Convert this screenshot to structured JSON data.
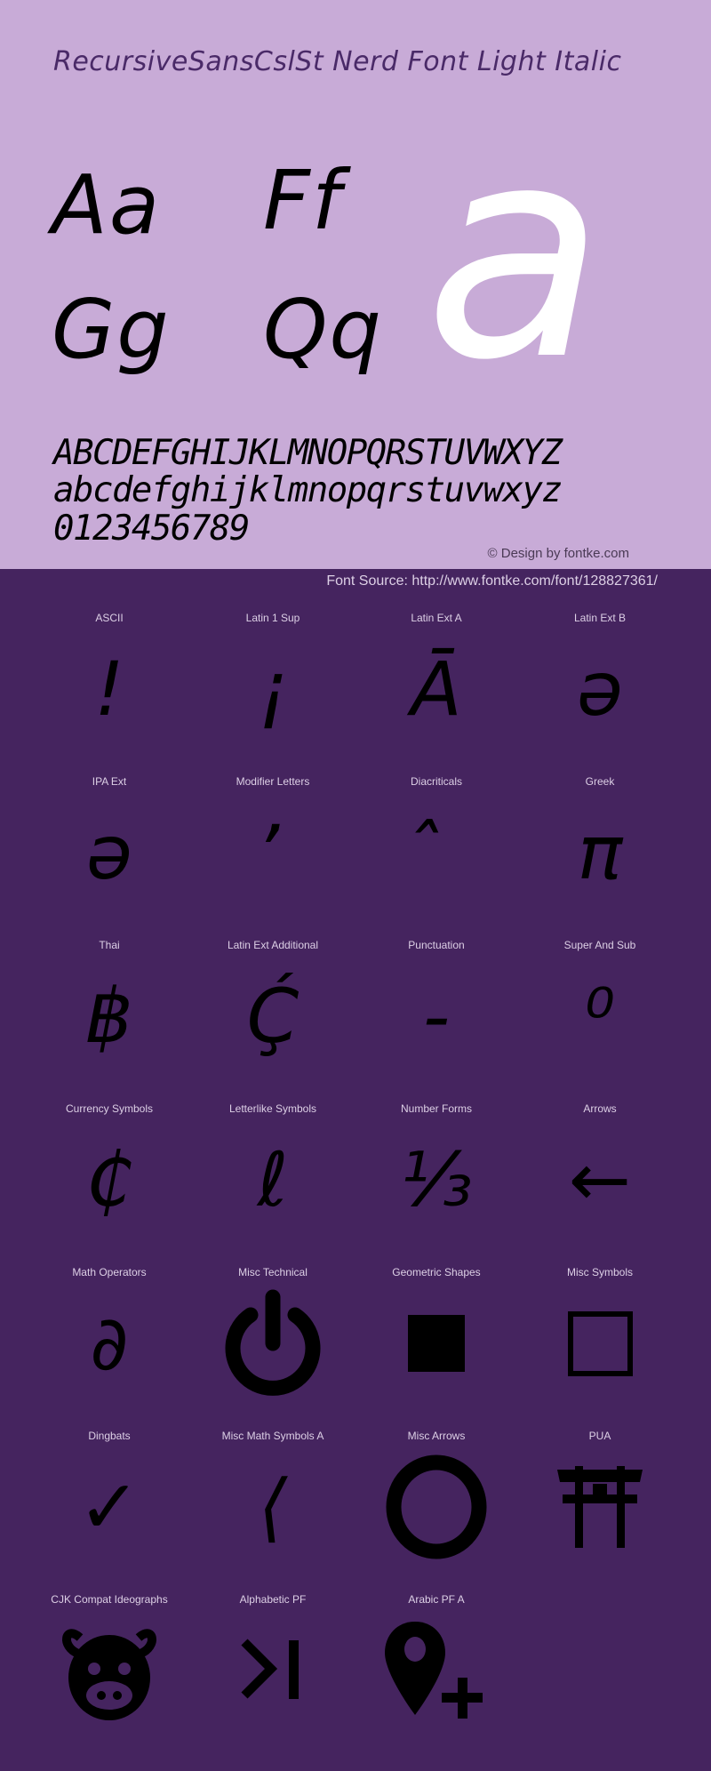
{
  "header": {
    "title": "RecursiveSansCslSt Nerd Font Light Italic"
  },
  "preview": {
    "pairs": [
      "Aa",
      "Ff",
      "Gg",
      "Qq"
    ],
    "hero_glyph": "a",
    "uppercase": "ABCDEFGHIJKLMNOPQRSTUVWXYZ",
    "lowercase": "abcdefghijklmnopqrstuvwxyz",
    "digits": "0123456789",
    "credit": "© Design by fontke.com",
    "source": "Font Source: http://www.fontke.com/font/128827361/"
  },
  "colors": {
    "top_background": "#c8abd7",
    "bottom_background": "#45245f",
    "title_color": "#4a2a68",
    "hero_glyph_color": "#ffffff",
    "label_color": "#ddd0e6"
  },
  "blocks": [
    {
      "label": "ASCII",
      "glyph": "!"
    },
    {
      "label": "Latin 1 Sup",
      "glyph": "¡"
    },
    {
      "label": "Latin Ext A",
      "glyph": "Ā"
    },
    {
      "label": "Latin Ext B",
      "glyph": "ə"
    },
    {
      "label": "IPA Ext",
      "glyph": "ə"
    },
    {
      "label": "Modifier Letters",
      "glyph": "ʼ"
    },
    {
      "label": "Diacriticals",
      "glyph": "̂"
    },
    {
      "label": "Greek",
      "glyph": "π"
    },
    {
      "label": "Thai",
      "glyph": "฿"
    },
    {
      "label": "Latin Ext Additional",
      "glyph": "Ḉ"
    },
    {
      "label": "Punctuation",
      "glyph": "‐"
    },
    {
      "label": "Super And Sub",
      "glyph": "⁰"
    },
    {
      "label": "Currency Symbols",
      "glyph": "₵"
    },
    {
      "label": "Letterlike Symbols",
      "glyph": "ℓ"
    },
    {
      "label": "Number Forms",
      "glyph": "⅓"
    },
    {
      "label": "Arrows",
      "glyph": "←"
    },
    {
      "label": "Math Operators",
      "glyph": "∂"
    },
    {
      "label": "Misc Technical",
      "glyph": "power-icon"
    },
    {
      "label": "Geometric Shapes",
      "glyph": "■"
    },
    {
      "label": "Misc Symbols",
      "glyph": "□"
    },
    {
      "label": "Dingbats",
      "glyph": "✓"
    },
    {
      "label": "Misc Math Symbols A",
      "glyph": "⟨"
    },
    {
      "label": "Misc Arrows",
      "glyph": "⭕"
    },
    {
      "label": "PUA",
      "glyph": "torii-gate-icon"
    },
    {
      "label": "CJK Compat Ideographs",
      "glyph": "pig-face-icon"
    },
    {
      "label": "Alphabetic PF",
      "glyph": "terminal-prompt-icon"
    },
    {
      "label": "Arabic PF A",
      "glyph": "map-marker-plus-icon"
    }
  ]
}
